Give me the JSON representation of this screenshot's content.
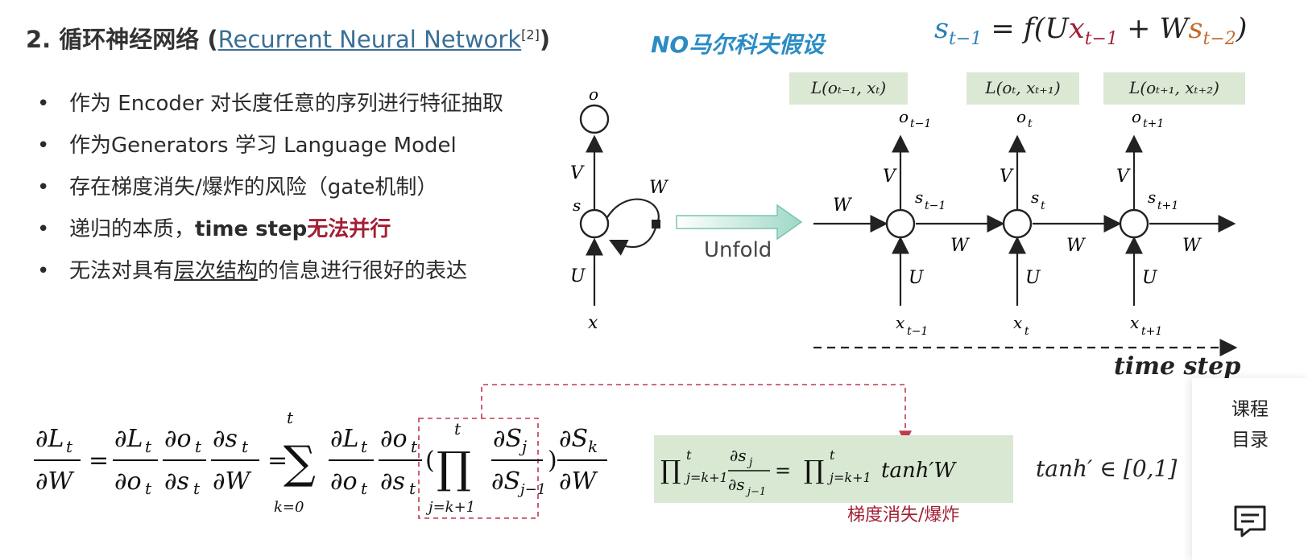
{
  "title": {
    "prefix": "2. 循环神经网络 (",
    "link": "Recurrent Neural Network",
    "ref": "[2]",
    "suffix": ")"
  },
  "tag": "NO马尔科夫假设",
  "top_equation": {
    "lhs": "s",
    "lhs_sub": "t−1",
    "eq": " = f(U",
    "x": "x",
    "x_sub": "t−1",
    "plus": " + W",
    "s2": "s",
    "s2_sub": "t−2",
    "close": ")"
  },
  "bullets": [
    {
      "text": "作为 Encoder 对长度任意的序列进行特征抽取"
    },
    {
      "text": "作为Generators 学习 Language Model"
    },
    {
      "text": "存在梯度消失/爆炸的风险（gate机制）"
    },
    {
      "pre": "递归的本质，",
      "bold": "time step",
      "hl": "无法并行"
    },
    {
      "pre": "无法对具有",
      "underline": "层次结构",
      "post": "的信息进行很好的表达"
    }
  ],
  "diagram": {
    "folded": {
      "o": "o",
      "s": "s",
      "x": "x",
      "V": "V",
      "U": "U",
      "W": "W"
    },
    "unfold_label": "Unfold",
    "loss_labels": [
      "L(o",
      "L(o",
      "L(o"
    ],
    "loss": [
      "L(oₜ₋₁, xₜ)",
      "L(oₜ, xₜ₊₁)",
      "L(oₜ₊₁, xₜ₊₂)"
    ],
    "steps": [
      {
        "o": "o",
        "o_sub": "t−1",
        "s": "s",
        "s_sub": "t−1",
        "x": "x",
        "x_sub": "t−1"
      },
      {
        "o": "o",
        "o_sub": "t",
        "s": "s",
        "s_sub": "t",
        "x": "x",
        "x_sub": "t"
      },
      {
        "o": "o",
        "o_sub": "t+1",
        "s": "s",
        "s_sub": "t+1",
        "x": "x",
        "x_sub": "t+1"
      }
    ],
    "weight_labels": {
      "V": "V",
      "U": "U",
      "W": "W"
    },
    "time_label": "time step"
  },
  "gradient_label": "梯度消失/爆炸",
  "tanh_range": "tanh′ ∈ [0,1]",
  "side_panel": {
    "catalog_line1": "课程",
    "catalog_line2": "目录"
  },
  "colors": {
    "accent_red": "#a21f35",
    "accent_blue": "#2b8cc4",
    "green_box": "#d9e8d2"
  }
}
